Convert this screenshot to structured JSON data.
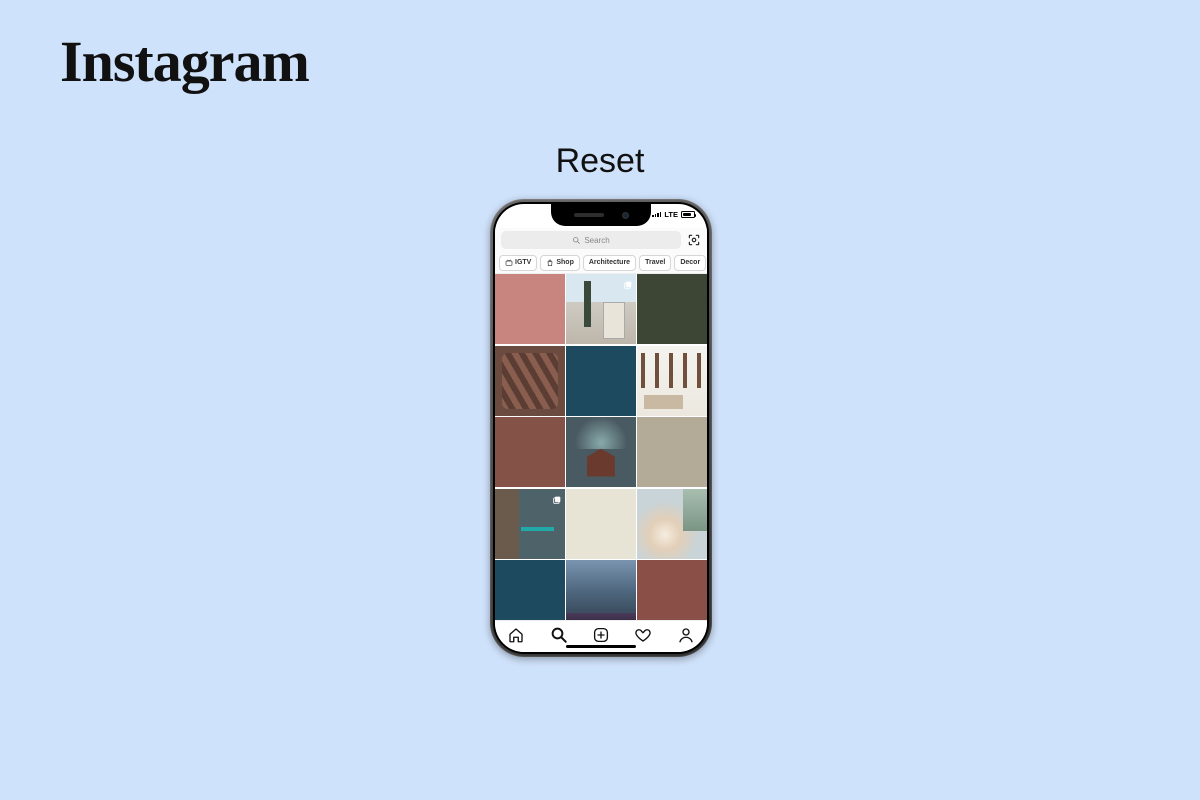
{
  "brand": {
    "logo_text": "Instagram"
  },
  "heading": "Reset",
  "status": {
    "carrier": "LTE"
  },
  "search": {
    "placeholder": "Search"
  },
  "chips": [
    {
      "label": "IGTV",
      "icon": "tv"
    },
    {
      "label": "Shop",
      "icon": "bag"
    },
    {
      "label": "Architecture",
      "icon": null
    },
    {
      "label": "Travel",
      "icon": null
    },
    {
      "label": "Decor",
      "icon": null
    }
  ],
  "grid": [
    {
      "bg": "#c8847e",
      "photo": null,
      "carousel": false
    },
    {
      "bg": null,
      "photo": "photo1",
      "carousel": true
    },
    {
      "bg": "#3d4534",
      "photo": null,
      "carousel": false
    },
    {
      "bg": null,
      "photo": "photo2",
      "carousel": false
    },
    {
      "bg": "#1d4a5e",
      "photo": null,
      "carousel": false
    },
    {
      "bg": null,
      "photo": "photo3",
      "carousel": false
    },
    {
      "bg": "#855248",
      "photo": null,
      "carousel": false
    },
    {
      "bg": null,
      "photo": "photo4",
      "carousel": true
    },
    {
      "bg": "#b3ab98",
      "photo": null,
      "carousel": false
    },
    {
      "bg": null,
      "photo": "photo5",
      "carousel": true
    },
    {
      "bg": "#e7e4d6",
      "photo": null,
      "carousel": false
    },
    {
      "bg": null,
      "photo": "photo6",
      "carousel": false
    },
    {
      "bg": "#1d4a5e",
      "photo": null,
      "carousel": false
    },
    {
      "bg": null,
      "photo": "photo7",
      "carousel": false
    },
    {
      "bg": "#8a4f46",
      "photo": null,
      "carousel": false
    }
  ],
  "nav": {
    "active": "search"
  }
}
